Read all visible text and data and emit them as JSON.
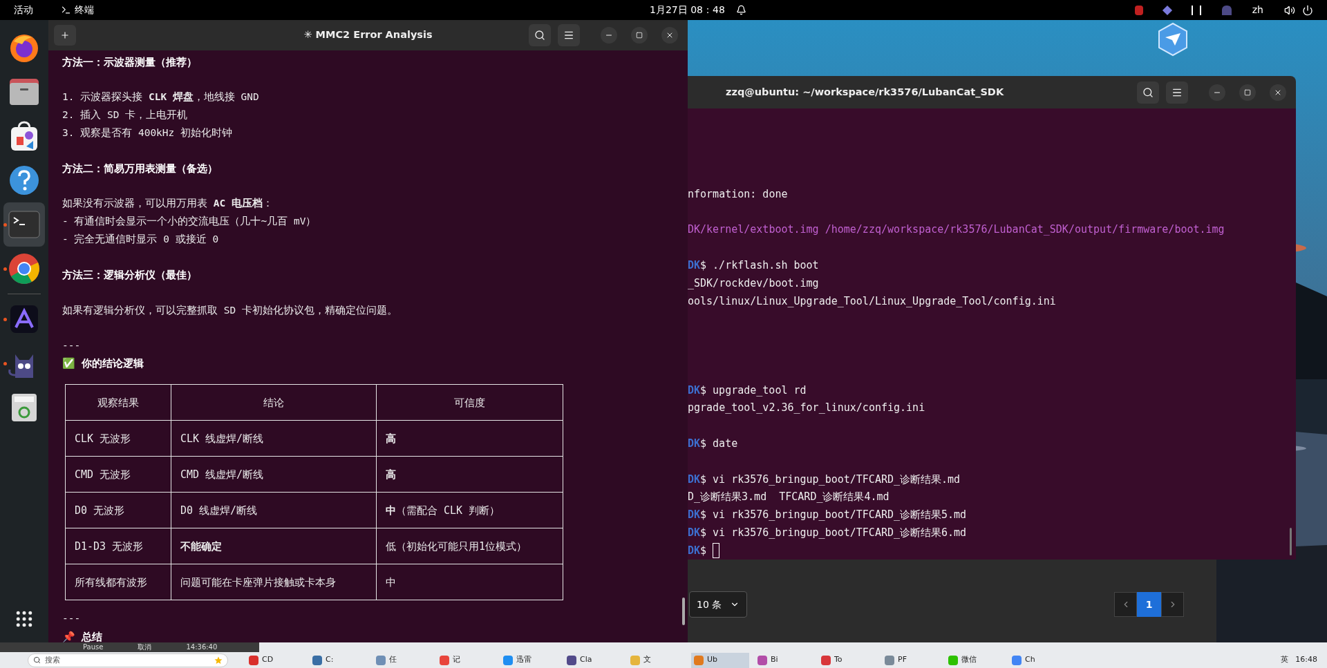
{
  "top_bar": {
    "activities": "活动",
    "app": "终端",
    "clock": "1月27日 08：48",
    "language": "zh"
  },
  "dock": [
    {
      "kind": "firefox",
      "running": false,
      "selected": false
    },
    {
      "kind": "files",
      "running": false,
      "selected": false
    },
    {
      "kind": "store",
      "running": false,
      "selected": false
    },
    {
      "kind": "help",
      "running": false,
      "selected": false
    },
    {
      "kind": "terminal",
      "running": true,
      "selected": true
    },
    {
      "kind": "chrome",
      "running": true,
      "selected": false
    },
    {
      "kind": "ai",
      "running": true,
      "selected": false
    },
    {
      "kind": "cat",
      "running": true,
      "selected": false
    },
    {
      "kind": "trash",
      "running": false,
      "selected": false
    }
  ],
  "left_window": {
    "title": "✳ MMC2 Error Analysis",
    "lines": [
      {
        "kind": "heading",
        "text": "方法一：示波器测量（推荐）"
      },
      {
        "kind": "blank"
      },
      {
        "kind": "text",
        "text": "1. 示波器探头接 **CLK 焊盘**，地线接 GND"
      },
      {
        "kind": "text",
        "text": "2. 插入 SD 卡，上电开机"
      },
      {
        "kind": "text",
        "text": "3. 观察是否有 400kHz 初始化时钟"
      },
      {
        "kind": "blank"
      },
      {
        "kind": "heading",
        "text": "方法二：简易万用表测量（备选）"
      },
      {
        "kind": "blank"
      },
      {
        "kind": "text",
        "text": "如果没有示波器，可以用万用表 **AC 电压档**："
      },
      {
        "kind": "text",
        "text": "- 有通信时会显示一个小的交流电压（几十~几百 mV）"
      },
      {
        "kind": "text",
        "text": "- 完全无通信时显示 0 或接近 0"
      },
      {
        "kind": "blank"
      },
      {
        "kind": "heading",
        "text": "方法三：逻辑分析仪（最佳）"
      },
      {
        "kind": "blank"
      },
      {
        "kind": "text",
        "text": "如果有逻辑分析仪，可以完整抓取 SD 卡初始化协议包，精确定位问题。"
      },
      {
        "kind": "blank"
      },
      {
        "kind": "text",
        "text": "---"
      },
      {
        "kind": "heading",
        "text": "✅ 你的结论逻辑"
      },
      {
        "kind": "table",
        "columns": [
          "观察结果",
          "结论",
          "可信度"
        ],
        "rows": [
          [
            "CLK 无波形",
            "CLK 线虚焊/断线",
            "**高**"
          ],
          [
            "CMD 无波形",
            "CMD 线虚焊/断线",
            "**高**"
          ],
          [
            "D0 无波形",
            "D0 线虚焊/断线",
            "**中**（需配合 CLK 判断）"
          ],
          [
            "D1-D3 无波形",
            "**不能确定**",
            "低（初始化可能只用1位模式）"
          ],
          [
            "所有线都有波形",
            "问题可能在卡座弹片接触或卡本身",
            "中"
          ]
        ]
      },
      {
        "kind": "text",
        "text": "---"
      },
      {
        "kind": "heading",
        "text": "📌 总结"
      }
    ]
  },
  "right_window": {
    "title": "zzq@ubuntu: ~/workspace/rk3576/LubanCat_SDK",
    "lines": [
      {
        "kind": "blank"
      },
      {
        "kind": "blank"
      },
      {
        "kind": "blank"
      },
      {
        "kind": "blank"
      },
      {
        "kind": "output",
        "text": "nformation: done"
      },
      {
        "kind": "blank"
      },
      {
        "kind": "highlight",
        "text": "DK/kernel/extboot.img /home/zzq/workspace/rk3576/LubanCat_SDK/output/firmware/boot.img"
      },
      {
        "kind": "blank"
      },
      {
        "kind": "prompt",
        "host": "DK",
        "sign": "$",
        "command": "./rkflash.sh boot",
        "cursor": false
      },
      {
        "kind": "output",
        "text": "_SDK/rockdev/boot.img"
      },
      {
        "kind": "output",
        "text": "ools/linux/Linux_Upgrade_Tool/Linux_Upgrade_Tool/config.ini"
      },
      {
        "kind": "blank"
      },
      {
        "kind": "blank"
      },
      {
        "kind": "blank"
      },
      {
        "kind": "blank"
      },
      {
        "kind": "prompt",
        "host": "DK",
        "sign": "$",
        "command": "upgrade_tool rd",
        "cursor": false
      },
      {
        "kind": "output",
        "text": "pgrade_tool_v2.36_for_linux/config.ini"
      },
      {
        "kind": "blank"
      },
      {
        "kind": "prompt",
        "host": "DK",
        "sign": "$",
        "command": "date",
        "cursor": false
      },
      {
        "kind": "blank"
      },
      {
        "kind": "prompt",
        "host": "DK",
        "sign": "$",
        "command": "vi rk3576_bringup_boot/TFCARD_诊断结果.md",
        "cursor": false
      },
      {
        "kind": "output",
        "text": "D_诊断结果3.md  TFCARD_诊断结果4.md"
      },
      {
        "kind": "prompt",
        "host": "DK",
        "sign": "$",
        "command": "vi rk3576_bringup_boot/TFCARD_诊断结果5.md",
        "cursor": false
      },
      {
        "kind": "prompt",
        "host": "DK",
        "sign": "$",
        "command": "vi rk3576_bringup_boot/TFCARD_诊断结果6.md",
        "cursor": false
      },
      {
        "kind": "prompt",
        "host": "DK",
        "sign": "$",
        "cursor": true
      }
    ]
  },
  "pager": {
    "page_size": "10 条",
    "pages": [
      {
        "label": "1",
        "selected": true
      }
    ]
  },
  "bottom": {
    "status": [
      "Pause",
      "取消",
      "14:36:40"
    ],
    "search": {
      "placeholder": "搜索"
    },
    "apps": [
      {
        "label": "CD",
        "color": "#d9302c",
        "selected": false
      },
      {
        "label": "C:",
        "color": "#3a6ea5",
        "selected": false
      },
      {
        "label": "任",
        "color": "#6f8fb5",
        "selected": false
      },
      {
        "label": "记",
        "color": "#e8453c",
        "selected": false
      },
      {
        "label": "迅雷",
        "color": "#1f8ef1",
        "selected": false
      },
      {
        "label": "Cla",
        "color": "#524a8a",
        "selected": false
      },
      {
        "label": "文",
        "color": "#e5b53d",
        "selected": false
      },
      {
        "label": "Ub",
        "color": "#e07a1f",
        "selected": true
      },
      {
        "label": "Bi",
        "color": "#b24da8",
        "selected": false
      },
      {
        "label": "To",
        "color": "#d8363a",
        "selected": false
      },
      {
        "label": "PF",
        "color": "#7a8a99",
        "selected": false
      },
      {
        "label": "微信",
        "color": "#2dc100",
        "selected": false
      },
      {
        "label": "Ch",
        "color": "#4285f4",
        "selected": false
      }
    ],
    "ime": "英",
    "clock": "16:48"
  }
}
